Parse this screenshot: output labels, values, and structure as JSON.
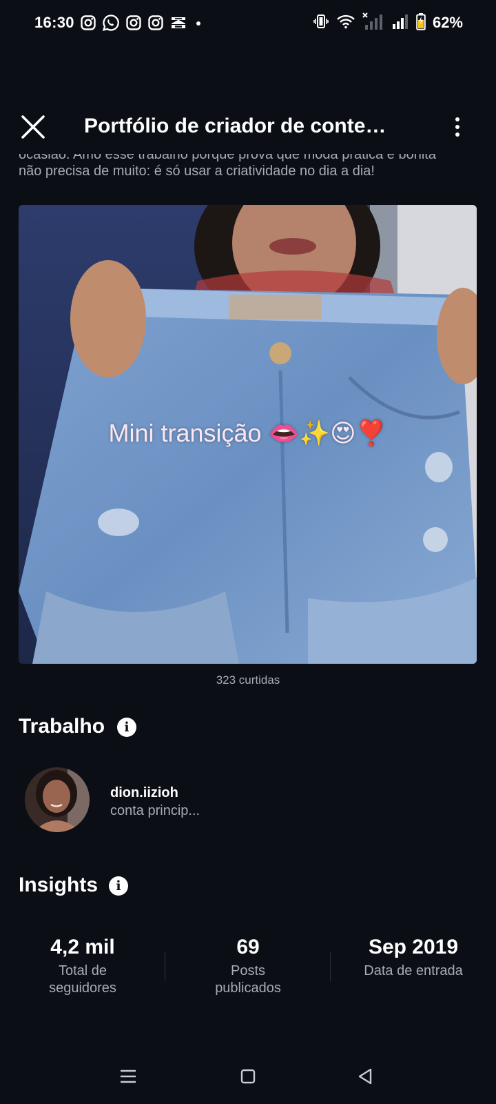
{
  "status_bar": {
    "time": "16:30",
    "battery_percent": "62%",
    "notification_icons": [
      "instagram-icon",
      "whatsapp-icon",
      "instagram-icon",
      "instagram-icon",
      "capcut-icon",
      "dot-icon"
    ],
    "system_icons": [
      "vibrate-icon",
      "wifi-icon",
      "signal-no-service-icon",
      "signal-icon",
      "battery-charging-icon"
    ]
  },
  "header": {
    "title": "Portfólio de criador de conteúdo",
    "close_icon": "close-icon",
    "more_icon": "more-vertical-icon"
  },
  "description": {
    "line1": "ocasião. Amo esse trabalho porque prova que moda prática e bonita",
    "line2": "não precisa de muito: é só usar a criatividade no dia a dia!"
  },
  "media": {
    "caption": "Mini transição 👄✨😍❣️",
    "likes": "323 curtidas"
  },
  "work": {
    "title": "Trabalho",
    "info_icon": "info-icon",
    "account": {
      "username": "dion.iizioh",
      "subtitle": "conta princip..."
    }
  },
  "insights": {
    "title": "Insights",
    "info_icon": "info-icon",
    "stats": [
      {
        "value": "4,2 mil",
        "label_line1": "Total de",
        "label_line2": "seguidores"
      },
      {
        "value": "69",
        "label_line1": "Posts",
        "label_line2": "publicados"
      },
      {
        "value": "Sep 2019",
        "label_line1": "Data de entrada",
        "label_line2": ""
      }
    ]
  },
  "nav_bar": {
    "icons": [
      "menu-icon",
      "home-square-icon",
      "back-triangle-icon"
    ]
  },
  "colors": {
    "background": "#0b0f15",
    "text_primary": "#ffffff",
    "text_secondary": "#a6abb4",
    "divider": "#2c313a"
  }
}
